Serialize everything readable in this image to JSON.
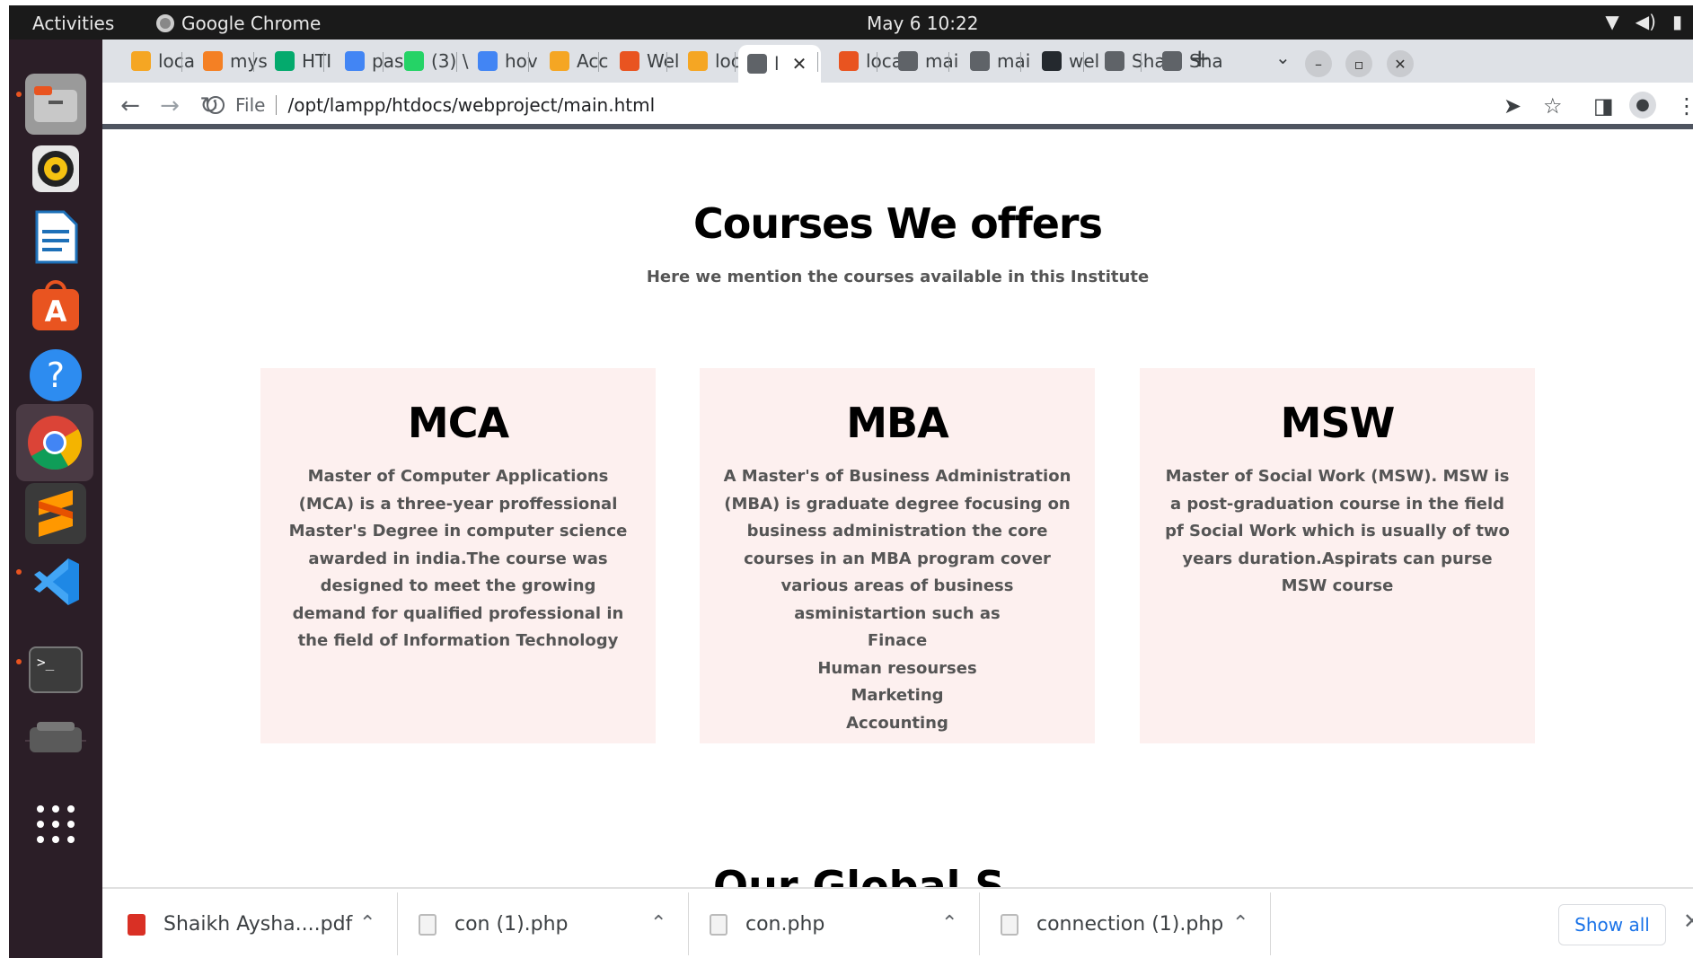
{
  "system_bar": {
    "activities": "Activities",
    "app_name": "Google Chrome",
    "clock": "May 6  10:22"
  },
  "tabs": [
    {
      "label": "loca",
      "icon_color": "#f5a623"
    },
    {
      "label": "mys",
      "icon_color": "#f48024"
    },
    {
      "label": "HTI",
      "icon_color": "#04aa6d"
    },
    {
      "label": "pas",
      "icon_color": "#4285f4"
    },
    {
      "label": "(3) \\",
      "icon_color": "#25d366"
    },
    {
      "label": "hov",
      "icon_color": "#4285f4"
    },
    {
      "label": "Acc",
      "icon_color": "#f5a623"
    },
    {
      "label": "Wel",
      "icon_color": "#e95420"
    },
    {
      "label": "loca",
      "icon_color": "#f5a623"
    },
    {
      "label": "l",
      "icon_color": "#5f6368",
      "active": true
    },
    {
      "label": "loca",
      "icon_color": "#e95420"
    },
    {
      "label": "mai",
      "icon_color": "#5f6368"
    },
    {
      "label": "mai",
      "icon_color": "#5f6368"
    },
    {
      "label": "wel",
      "icon_color": "#24292e"
    },
    {
      "label": "Sha",
      "icon_color": "#5f6368"
    },
    {
      "label": "Sha",
      "icon_color": "#5f6368"
    }
  ],
  "toolbar": {
    "file_label": "File",
    "url": "/opt/lampp/htdocs/webproject/main.html"
  },
  "page": {
    "title": "Courses We offers",
    "subtitle": "Here we mention the courses available in this Institute",
    "courses": [
      {
        "name": "MCA",
        "description": "Master of Computer Applications (MCA) is a three-year proffessional Master's Degree in computer science awarded in india.The course was designed to meet the growing demand for qualified professional in the field of Information Technology",
        "items": []
      },
      {
        "name": "MBA",
        "description": "A Master's of Business Administration (MBA) is graduate degree focusing on business administration the core courses in an MBA program cover various areas of business asministartion such as",
        "items": [
          "Finace",
          "Human resourses",
          "Marketing",
          "Accounting"
        ]
      },
      {
        "name": "MSW",
        "description": "Master of Social Work (MSW). MSW is a post-graduation course in the field pf Social Work which is usually of two years duration.Aspirats can purse MSW course",
        "items": []
      }
    ],
    "next_heading": "Our Global S"
  },
  "downloads": {
    "items": [
      {
        "name": "Shaikh Aysha....pdf",
        "type": "pdf"
      },
      {
        "name": "con (1).php",
        "type": "php"
      },
      {
        "name": "con.php",
        "type": "php"
      },
      {
        "name": "connection (1).php",
        "type": "php"
      }
    ],
    "show_all": "Show all"
  }
}
